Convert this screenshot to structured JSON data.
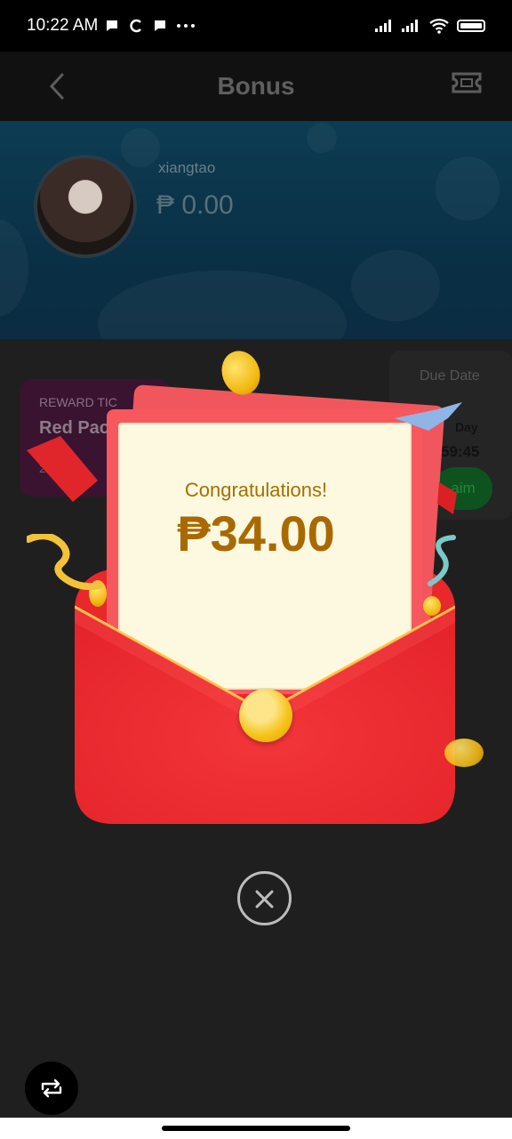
{
  "status_bar": {
    "time": "10:22 AM",
    "left_icons": [
      "chat-icon",
      "c-icon",
      "message-icon",
      "more-icon"
    ],
    "battery": "battery-icon"
  },
  "header": {
    "title": "Bonus",
    "back_icon": "chevron-left-icon",
    "ticket_icon": "ticket-icon"
  },
  "profile": {
    "username": "xiangtao",
    "balance": "₱ 0.00"
  },
  "ticket": {
    "small_label": "REWARD TIC",
    "name": "Red Pac",
    "amount": "24.0"
  },
  "due_card": {
    "label": "Due Date",
    "day": "Day",
    "countdown": "59:45",
    "claim": "aim"
  },
  "popup": {
    "congrats": "Congratulations!",
    "amount": "₱34.00",
    "close_icon": "close-circle-icon"
  },
  "bottom": {
    "repeat_icon": "repeat-icon"
  },
  "colors": {
    "envelope_red": "#e9282c",
    "paper": "#fdf8e0",
    "gold_text": "#a86a00",
    "seal_gold": "#f5c319"
  }
}
